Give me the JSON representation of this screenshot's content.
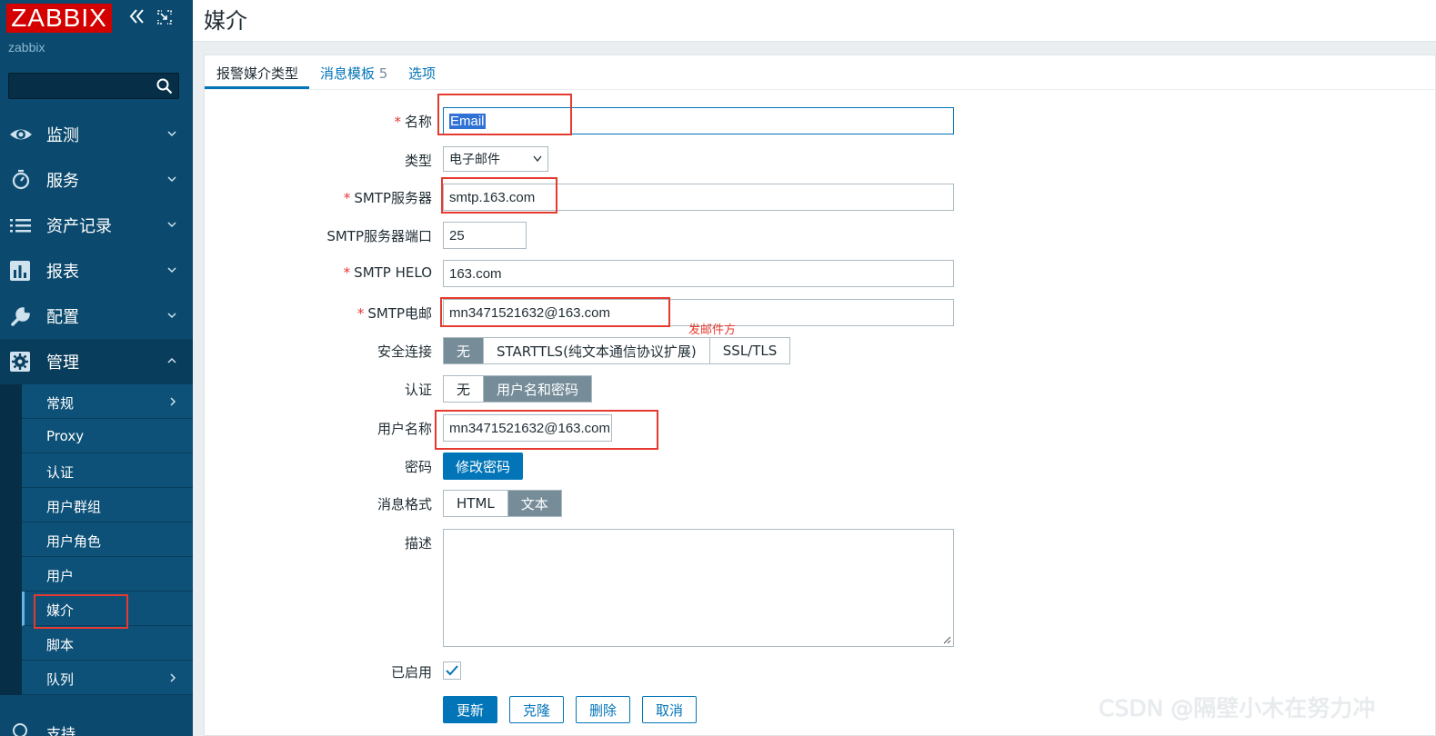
{
  "app": {
    "logo": "ZABBIX",
    "server_name": "zabbix"
  },
  "sidebar": {
    "search_placeholder": "",
    "menu": [
      {
        "label": "监测",
        "icon": "eye-icon"
      },
      {
        "label": "服务",
        "icon": "stopwatch-icon"
      },
      {
        "label": "资产记录",
        "icon": "list-icon"
      },
      {
        "label": "报表",
        "icon": "bar-chart-icon"
      },
      {
        "label": "配置",
        "icon": "wrench-icon"
      },
      {
        "label": "管理",
        "icon": "gear-icon"
      }
    ],
    "admin_submenu": [
      {
        "label": "常规",
        "has_children": true
      },
      {
        "label": "Proxy"
      },
      {
        "label": "认证"
      },
      {
        "label": "用户群组"
      },
      {
        "label": "用户角色"
      },
      {
        "label": "用户"
      },
      {
        "label": "媒介",
        "active": true
      },
      {
        "label": "脚本"
      },
      {
        "label": "队列",
        "has_children": true
      }
    ],
    "support_label": "支持"
  },
  "header": {
    "title": "媒介"
  },
  "tabs": [
    {
      "label": "报警媒介类型",
      "active": true
    },
    {
      "label": "消息模板",
      "count": "5"
    },
    {
      "label": "选项"
    }
  ],
  "form": {
    "name": {
      "label": "名称",
      "value": "Email"
    },
    "type": {
      "label": "类型",
      "value": "电子邮件"
    },
    "smtp_server": {
      "label": "SMTP服务器",
      "value": "smtp.163.com"
    },
    "smtp_port": {
      "label": "SMTP服务器端口",
      "value": "25"
    },
    "smtp_helo": {
      "label": "SMTP HELO",
      "value": "163.com"
    },
    "smtp_email": {
      "label": "SMTP电邮",
      "value": "mn3471521632@163.com"
    },
    "security": {
      "label": "安全连接",
      "options": [
        "无",
        "STARTTLS(纯文本通信协议扩展)",
        "SSL/TLS"
      ],
      "selected": "无"
    },
    "auth": {
      "label": "认证",
      "options": [
        "无",
        "用户名和密码"
      ],
      "selected": "用户名和密码"
    },
    "username": {
      "label": "用户名称",
      "value": "mn3471521632@163.com"
    },
    "password": {
      "label": "密码",
      "button": "修改密码"
    },
    "message_format": {
      "label": "消息格式",
      "options": [
        "HTML",
        "文本"
      ],
      "selected": "文本"
    },
    "description": {
      "label": "描述",
      "value": ""
    },
    "enabled": {
      "label": "已启用",
      "checked": true
    }
  },
  "actions": {
    "update": "更新",
    "clone": "克隆",
    "delete": "删除",
    "cancel": "取消"
  },
  "annotation": {
    "sender_note": "发邮件方"
  },
  "watermark": "CSDN @隔壁小木在努力冲",
  "colors": {
    "sidebar_bg": "#0b4a6e",
    "accent": "#0275b8",
    "logo_red": "#d40000",
    "annotation_red": "#e53a2f"
  }
}
